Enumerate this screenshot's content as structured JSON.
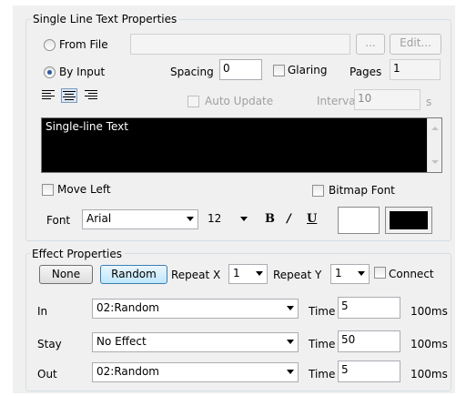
{
  "text_group": {
    "title": "Single Line Text Properties",
    "from_file_label": "From File",
    "from_file_path": "",
    "browse_button": "...",
    "edit_button": "Edit...",
    "by_input_label": "By Input",
    "spacing_label": "Spacing",
    "spacing_value": "0",
    "glaring_label": "Glaring",
    "pages_label": "Pages",
    "pages_value": "1",
    "auto_update_label": "Auto Update",
    "interval_label": "Interval",
    "interval_value": "10",
    "interval_unit": "s",
    "text_value": "Single-line Text",
    "move_left_label": "Move Left",
    "bitmap_font_label": "Bitmap Font",
    "font_label": "Font",
    "font_value": "Arial",
    "font_size_value": "12",
    "bold_glyph": "B",
    "italic_glyph": "/",
    "underline_glyph": "U",
    "fg_color": "#ffffff",
    "bg_color": "#000000"
  },
  "effect_group": {
    "title": "Effect Properties",
    "none_button": "None",
    "random_button": "Random",
    "repeat_x_label": "Repeat X",
    "repeat_x_value": "1",
    "repeat_y_label": "Repeat Y",
    "repeat_y_value": "1",
    "connect_label": "Connect",
    "rows": [
      {
        "label": "In",
        "effect": "02:Random",
        "time_label": "Time",
        "time_value": "5",
        "unit": "100ms"
      },
      {
        "label": "Stay",
        "effect": "No Effect",
        "time_label": "Time",
        "time_value": "50",
        "unit": "100ms"
      },
      {
        "label": "Out",
        "effect": "02:Random",
        "time_label": "Time",
        "time_value": "5",
        "unit": "100ms"
      }
    ]
  }
}
